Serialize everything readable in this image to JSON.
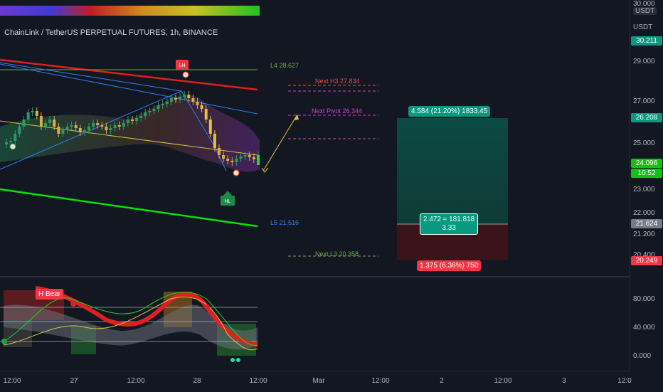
{
  "symbol_title": "ChainLink / TetherUS PERPETUAL FUTURES, 1h, BINANCE",
  "currency": "USDT",
  "top_axis_value": "30.000",
  "price_axis": {
    "ticks": [
      "29.000",
      "27.000",
      "25.000",
      "23.000",
      "22.000",
      "21.200",
      "20.400"
    ],
    "tags": [
      {
        "label": "30.211",
        "color": "#089981"
      },
      {
        "label": "26.208",
        "color": "#089981"
      },
      {
        "label": "24.096",
        "color": "#0ec40e"
      },
      {
        "label": "10:52",
        "color": "#0ec40e"
      },
      {
        "label": "21.624",
        "color": "#787b86"
      },
      {
        "label": "20.249",
        "color": "#f23645"
      }
    ]
  },
  "levels": {
    "l4": "L4 28.627",
    "next_h3": "Next H3 27.834",
    "next_pivot": "Next Pivot 26.344",
    "l5": "L5 21.516",
    "next_l3": "Next L3 20.358"
  },
  "position": {
    "target": "4.584 (21.20%) 1833.45",
    "middle_line1": "2.472 ≈ 181.818",
    "middle_line2": "3.33",
    "stop": "1.375 (6.36%) 750"
  },
  "markers": {
    "lh": "LH",
    "hl": "HL"
  },
  "oscillator": {
    "label": "H Bear",
    "ticks": [
      "80.000",
      "40.000",
      "0.000"
    ]
  },
  "time_axis": [
    "12:00",
    "27",
    "12:00",
    "28",
    "12:00",
    "Mar",
    "12:00",
    "2",
    "12:00",
    "3",
    "12:0"
  ],
  "colors": {
    "bg": "#131722",
    "up": "#089981",
    "down": "#f23645",
    "red_line": "#e01e1e",
    "green_line": "#00e600",
    "blue_line": "#2f80ed",
    "yellow_line": "#d8c24a"
  }
}
